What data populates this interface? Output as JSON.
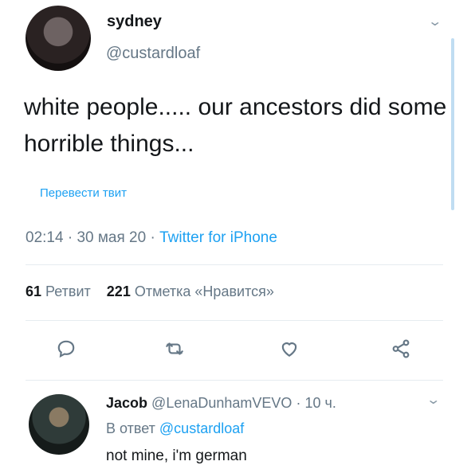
{
  "tweet": {
    "author_name": "sydney",
    "author_handle": "@custardloaf",
    "text": "white people..... our ancestors did some horrible things...",
    "translate_link": "Перевести твит",
    "time": "02:14",
    "date": "30 мая 20",
    "source": "Twitter for iPhone",
    "retweets_count": "61",
    "retweets_label": "Ретвит",
    "likes_count": "221",
    "likes_label": "Отметка «Нравится»"
  },
  "reply": {
    "author_name": "Jacob",
    "author_handle": "@LenaDunhamVEVO",
    "age": "10 ч.",
    "in_reply_prefix": "В ответ",
    "in_reply_handle": "@custardloaf",
    "text": "not mine, i'm german"
  },
  "icons": {
    "menu": "chevron-down-icon",
    "reply": "comment-icon",
    "retweet": "retweet-icon",
    "like": "heart-icon",
    "share": "share-icon"
  },
  "colors": {
    "link": "#1da1f2",
    "secondary": "#657786",
    "text": "#14171a"
  }
}
